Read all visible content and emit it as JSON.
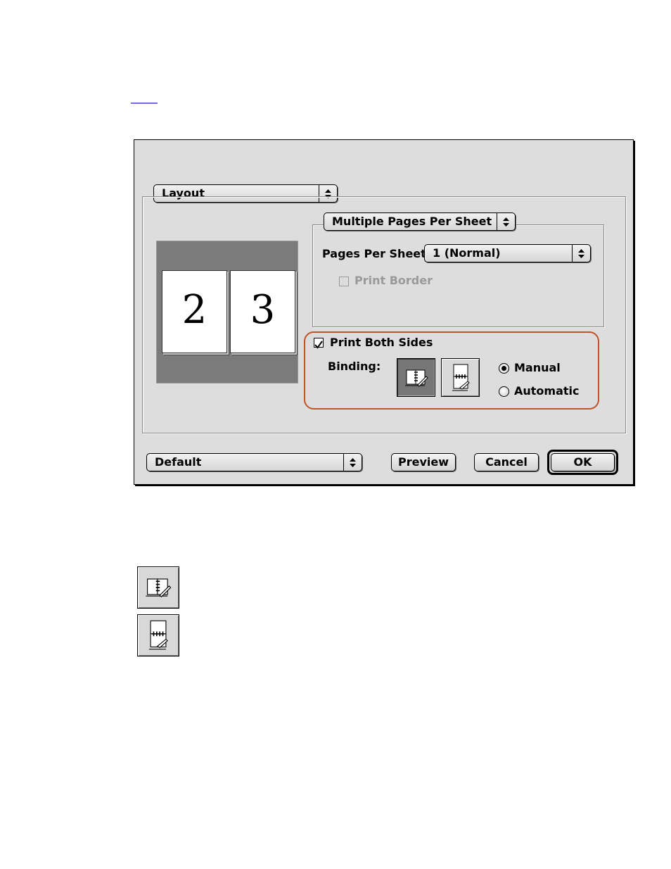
{
  "dialog": {
    "panel_popup": "Layout",
    "subpanel_popup": "Multiple Pages Per Sheet",
    "pages_per_sheet_label": "Pages Per Sheet:",
    "pages_per_sheet_value": "1 (Normal)",
    "print_border_label": "Print Border",
    "print_border_checked": false,
    "print_border_enabled": false,
    "preview_pages": [
      "2",
      "3"
    ],
    "print_both_sides_label": "Print Both Sides",
    "print_both_sides_checked": true,
    "binding_label": "Binding:",
    "binding_options": [
      "book-binding-icon",
      "tablet-binding-icon"
    ],
    "binding_selected": "book-binding-icon",
    "mode_manual_label": "Manual",
    "mode_automatic_label": "Automatic",
    "mode_selected": "Manual",
    "settings_popup": "Default",
    "preview_button": "Preview",
    "cancel_button": "Cancel",
    "ok_button": "OK",
    "highlight_color": "#c0532a"
  },
  "legend": {
    "icons": [
      "book-binding-icon",
      "tablet-binding-icon"
    ]
  }
}
